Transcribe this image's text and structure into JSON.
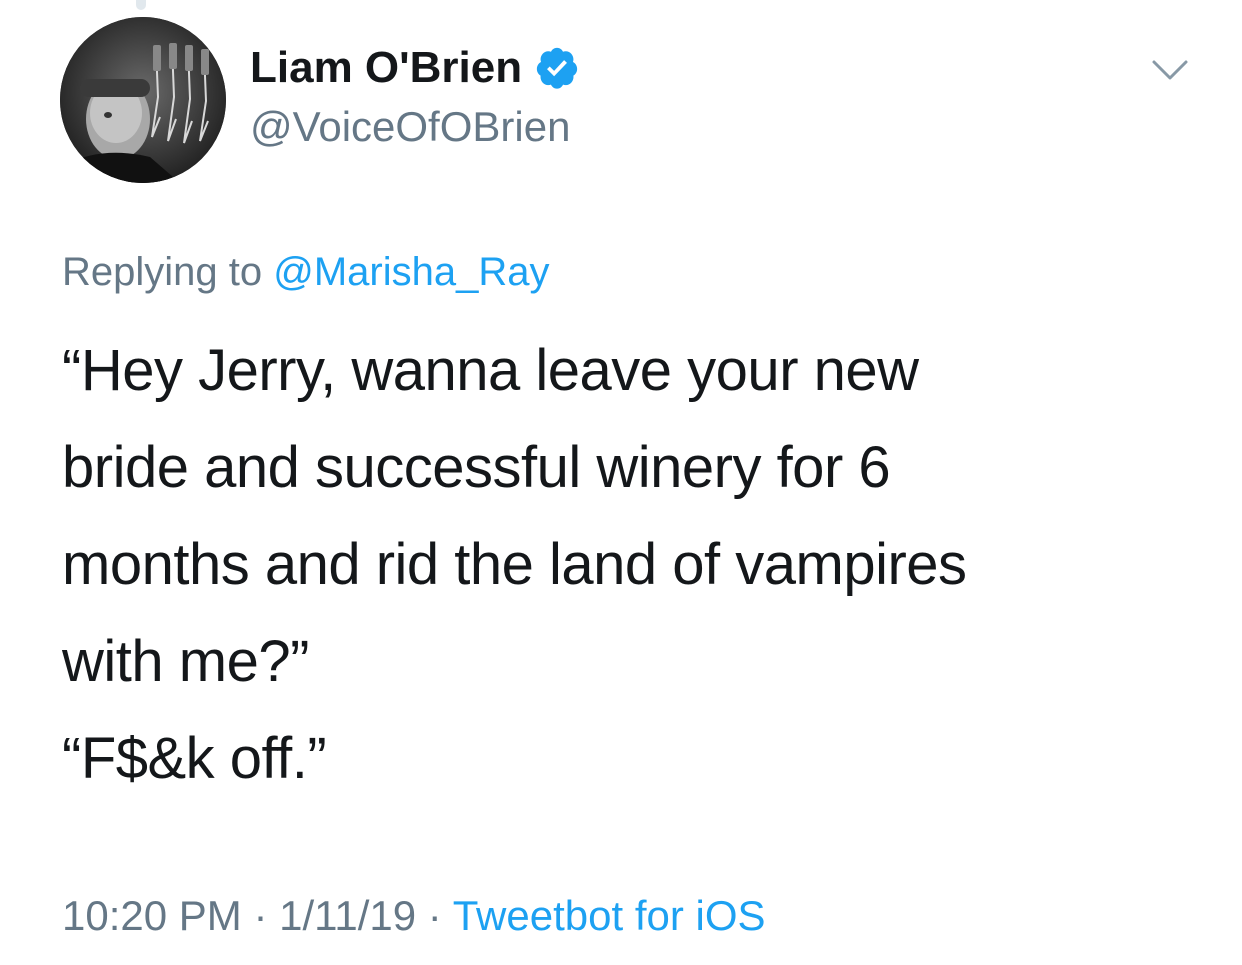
{
  "author": {
    "display_name": "Liam O'Brien",
    "handle": "@VoiceOfOBrien",
    "verified_icon": "verified-badge-icon",
    "avatar_icon": "avatar-photo"
  },
  "reply": {
    "prefix": "Replying to ",
    "mention": "@Marisha_Ray"
  },
  "tweet": {
    "paragraphs": [
      "“Hey Jerry, wanna leave your new\nbride and successful winery for 6\nmonths and rid the land of vampires\nwith me?”",
      "“F$&k off.”"
    ]
  },
  "footer": {
    "time": "10:20 PM",
    "separator1": " · ",
    "date": "1/11/19",
    "separator2": " · ",
    "source": "Tweetbot for iOS"
  },
  "menu_icon": "chevron-down-icon",
  "colors": {
    "text": "#14171a",
    "secondary": "#657786",
    "link": "#1da1f2",
    "verified": "#1da1f2"
  }
}
